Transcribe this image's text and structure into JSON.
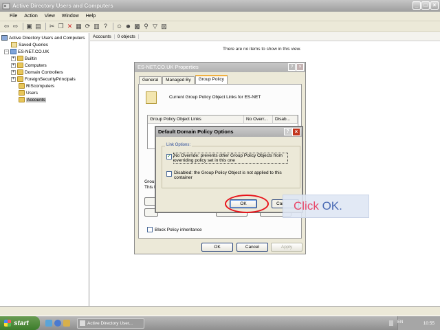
{
  "window": {
    "title": "Active Directory Users and Computers",
    "min": "_",
    "max": "□",
    "close": "×"
  },
  "menu": [
    "File",
    "Action",
    "View",
    "Window",
    "Help"
  ],
  "tree": {
    "root": "Active Directory Users and Computers",
    "saved_queries": "Saved Queries",
    "domain": "ES-NET.CO.UK",
    "items": [
      "Builtin",
      "Computers",
      "Domain Controllers",
      "ForeignSecurityPrincipals",
      "RIScomputers",
      "Users",
      "Accounts"
    ],
    "selected": "Accounts"
  },
  "right_pane": {
    "folder": "Accounts",
    "count": "0 objects",
    "empty_message": "There are no items to show in this view."
  },
  "properties_dialog": {
    "title": "ES-NET.CO.UK Properties",
    "tabs": [
      "General",
      "Managed By",
      "Group Policy"
    ],
    "active_tab": "Group Policy",
    "links_caption": "Current Group Policy Object Links for ES-NET",
    "columns": [
      "Group Policy Object Links",
      "No Overr...",
      "Disab..."
    ],
    "group_stub": "Group",
    "this_stub": "This l",
    "block_inheritance": "Block Policy inheritance",
    "ok": "OK",
    "cancel": "Cancel",
    "apply": "Apply"
  },
  "options_dialog": {
    "title": "Default Domain Policy Options",
    "help": "?",
    "close": "×",
    "group_label": "Link Options:",
    "no_override": "No Override: prevents other Group Policy Objects from overriding policy set in this one",
    "no_override_checked": true,
    "disabled": "Disabled: the Group Policy Object is not applied to this container",
    "disabled_checked": false,
    "ok": "OK",
    "cancel_stub": "Car"
  },
  "callout": {
    "text": "Click",
    "target": "OK."
  },
  "taskbar": {
    "start": "start",
    "task": "Active Directory User...",
    "lang": "EN",
    "clock": "10:55"
  }
}
